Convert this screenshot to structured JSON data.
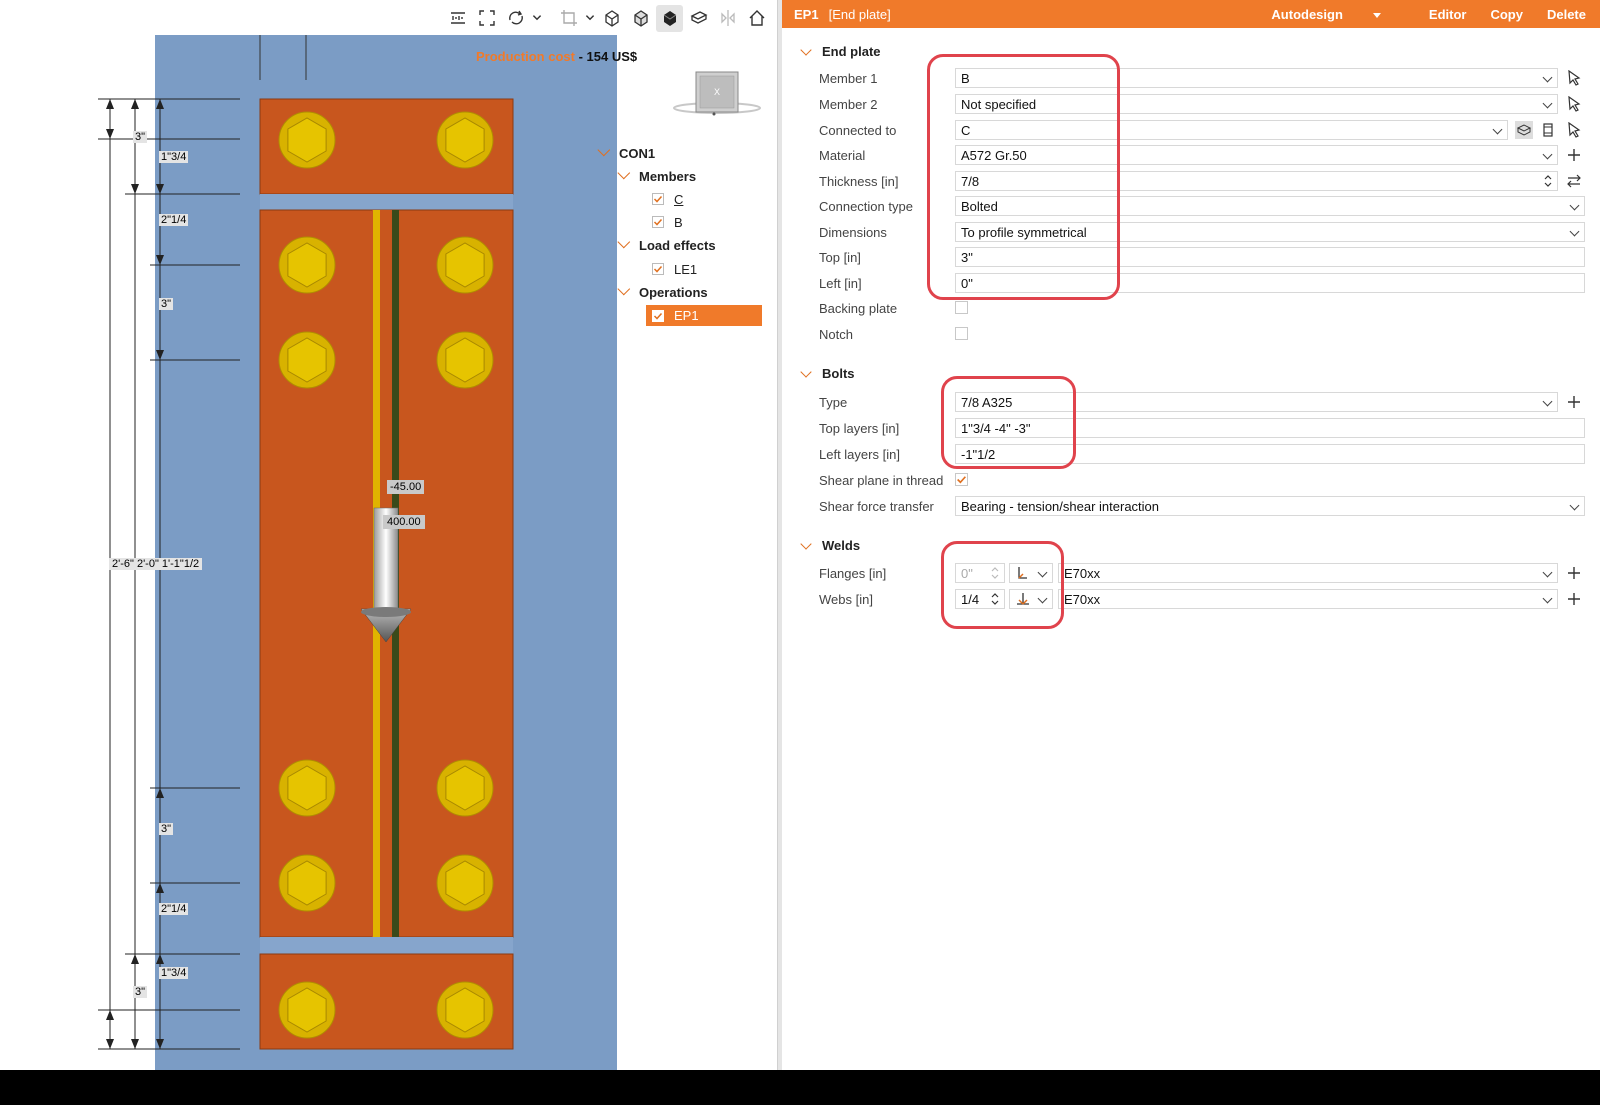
{
  "viewport": {
    "cost_label": "Production cost",
    "cost_value": "- 154 US$",
    "force_labels": [
      "-45.00",
      "400.00"
    ],
    "dimensions": {
      "left_outer": [
        "3\"",
        "3\""
      ],
      "right_col": [
        "1\"3/4",
        "2\"1/4",
        "3\"",
        "3\"",
        "2\"1/4",
        "1\"3/4"
      ],
      "total": "2'-6\" 2'-0\" 1'-1\"1/2"
    },
    "viewcube_label": "X"
  },
  "toolbar": {
    "icons": [
      "measure-icon",
      "fit-view-icon",
      "rotate-icon",
      "crop-icon",
      "wireframe-icon",
      "transparent-icon",
      "solid-icon",
      "cut-icon",
      "mirror-icon",
      "home-icon"
    ]
  },
  "tree": {
    "root": "CON1",
    "members_title": "Members",
    "members": [
      "C",
      "B"
    ],
    "load_effects_title": "Load effects",
    "load_effects": [
      "LE1"
    ],
    "operations_title": "Operations",
    "operations": [
      "EP1"
    ]
  },
  "panel": {
    "op_name": "EP1",
    "op_type": "[End plate]",
    "actions": {
      "autodesign": "Autodesign",
      "editor": "Editor",
      "copy": "Copy",
      "delete": "Delete"
    },
    "end_plate": {
      "title": "End plate",
      "member1_label": "Member 1",
      "member1_value": "B",
      "member2_label": "Member 2",
      "member2_value": "Not specified",
      "connected_label": "Connected to",
      "connected_value": "C",
      "material_label": "Material",
      "material_value": "A572 Gr.50",
      "thickness_label": "Thickness [in]",
      "thickness_value": "7/8",
      "conn_type_label": "Connection type",
      "conn_type_value": "Bolted",
      "dimensions_label": "Dimensions",
      "dimensions_value": "To profile symmetrical",
      "top_label": "Top [in]",
      "top_value": "3\"",
      "left_label": "Left [in]",
      "left_value": "0\"",
      "backing_label": "Backing plate",
      "notch_label": "Notch"
    },
    "bolts": {
      "title": "Bolts",
      "type_label": "Type",
      "type_value": "7/8 A325",
      "top_layers_label": "Top layers [in]",
      "top_layers_value": "1\"3/4 -4\" -3\"",
      "left_layers_label": "Left layers [in]",
      "left_layers_value": "-1\"1/2",
      "shear_thread_label": "Shear plane in thread",
      "shear_transfer_label": "Shear force transfer",
      "shear_transfer_value": "Bearing - tension/shear interaction"
    },
    "welds": {
      "title": "Welds",
      "flanges_label": "Flanges [in]",
      "flanges_value": "0\"",
      "flanges_material": "E70xx",
      "webs_label": "Webs [in]",
      "webs_value": "1/4",
      "webs_material": "E70xx"
    }
  },
  "colors": {
    "accent": "#f07a2a",
    "plate": "#c8561e",
    "bolt": "#d8b200",
    "background": "#7b9cc5",
    "highlight": "#e0434c"
  }
}
